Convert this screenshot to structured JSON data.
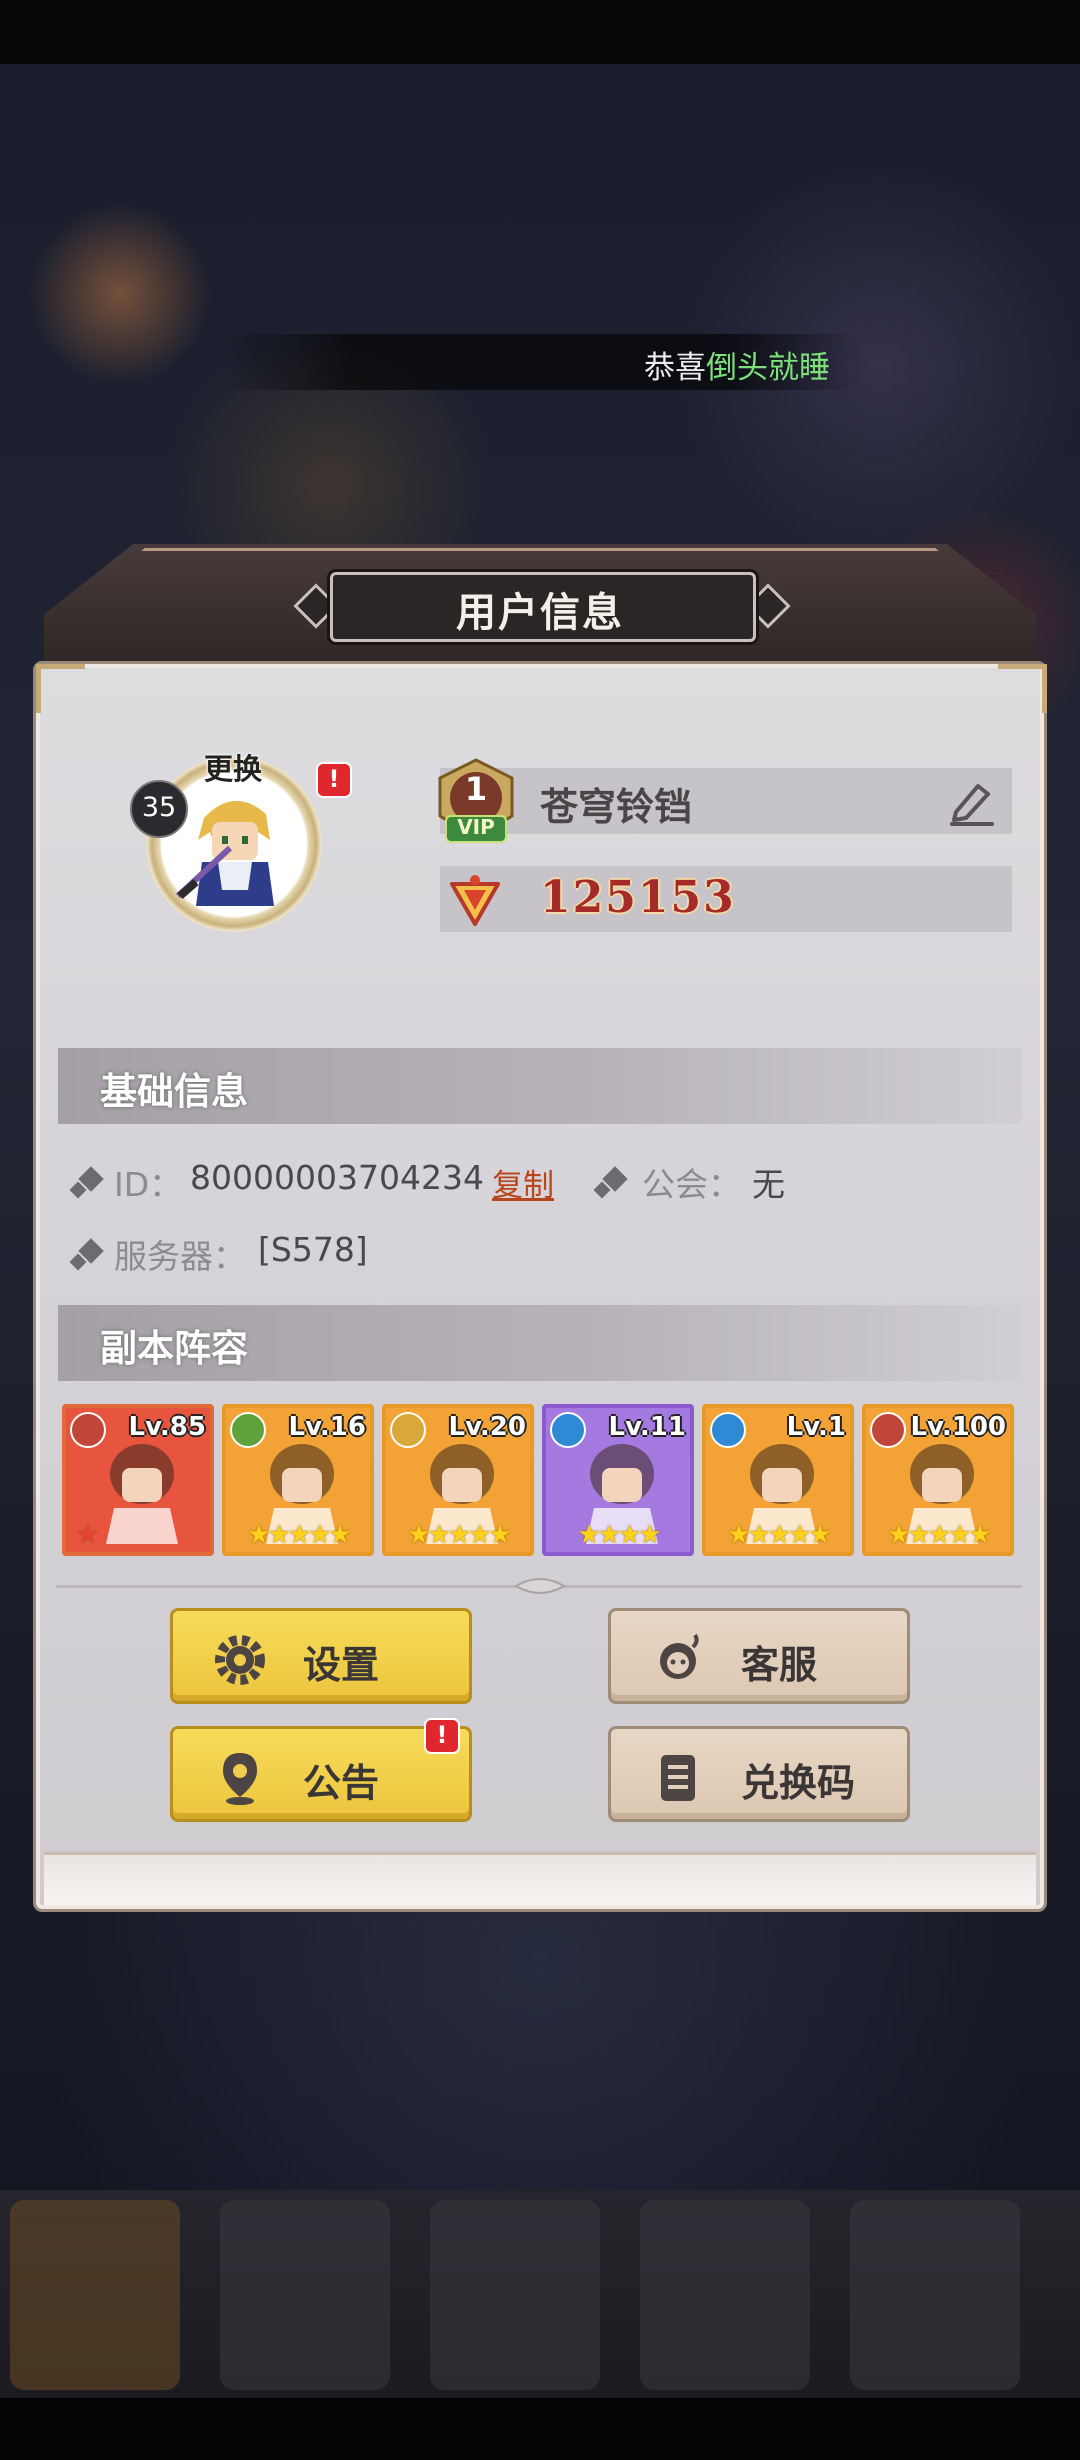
{
  "marquee": {
    "text_prefix": "恭喜",
    "text_highlight": "倒头就睡"
  },
  "dialog": {
    "title": "用户信息"
  },
  "profile": {
    "level": "35",
    "change_avatar_label": "更换",
    "alert_mark": "!",
    "vip_level": "1",
    "vip_text": "VIP",
    "nickname": "苍穹铃铛",
    "power": "125153"
  },
  "basic_info": {
    "section_title": "基础信息",
    "id_label": "ID：",
    "id_value": "80000003704234",
    "copy_label": "复制",
    "guild_label": "公会：",
    "guild_value": "无",
    "server_label": "服务器：",
    "server_value": "[S578]"
  },
  "lineup": {
    "section_title": "副本阵容",
    "heroes": [
      {
        "level": "Lv.85",
        "stars": "★",
        "frame": "#e06a3a",
        "bg": "#e8553e",
        "element_color": "#c0463a"
      },
      {
        "level": "Lv.16",
        "stars": "★★★★★",
        "frame": "#e89a28",
        "bg": "#f3a235",
        "element_color": "#5fa23a"
      },
      {
        "level": "Lv.20",
        "stars": "★★★★★",
        "frame": "#e89a28",
        "bg": "#f3a235",
        "element_color": "#d8a83a"
      },
      {
        "level": "Lv.11",
        "stars": "★★★★",
        "frame": "#8a5bd0",
        "bg": "#a57ae0",
        "element_color": "#2f8ad6"
      },
      {
        "level": "Lv.1",
        "stars": "★★★★★",
        "frame": "#e89a28",
        "bg": "#f3a235",
        "element_color": "#2f8ad6"
      },
      {
        "level": "Lv.100",
        "stars": "★★★★★",
        "frame": "#e89a28",
        "bg": "#f3a235",
        "element_color": "#c0463a"
      }
    ]
  },
  "buttons": {
    "settings": "设置",
    "customer_service": "客服",
    "announcement": "公告",
    "redeem_code": "兑换码"
  }
}
